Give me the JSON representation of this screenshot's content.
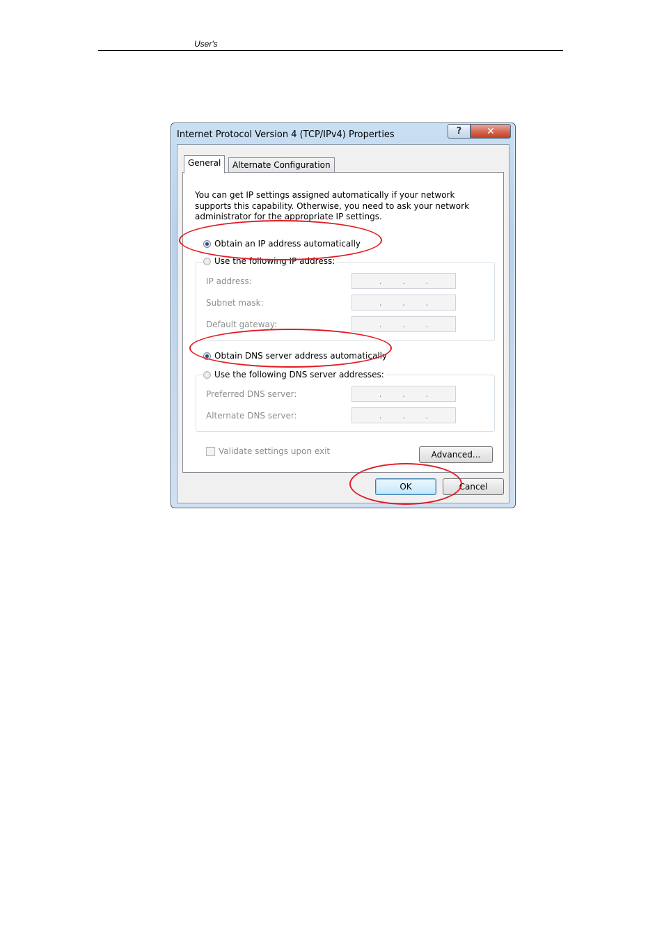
{
  "document": {
    "header_text": "User's"
  },
  "dialog": {
    "title": "Internet Protocol Version 4 (TCP/IPv4) Properties",
    "help_glyph": "?",
    "close_glyph": "✕",
    "tabs": [
      {
        "label": "General",
        "selected": true
      },
      {
        "label": "Alternate Configuration",
        "selected": false
      }
    ],
    "description": "You can get IP settings assigned automatically if your network supports this capability. Otherwise, you need to ask your network administrator for the appropriate IP settings.",
    "ip_mode": {
      "auto_label": "Obtain an IP address automatically",
      "auto_selected": true,
      "manual_label": "Use the following IP address:",
      "manual_selected": false
    },
    "ip_fields": {
      "ip_address_label": "IP address:",
      "subnet_mask_label": "Subnet mask:",
      "default_gateway_label": "Default gateway:",
      "dot": "."
    },
    "dns_mode": {
      "auto_label": "Obtain DNS server address automatically",
      "auto_selected": true,
      "manual_label": "Use the following DNS server addresses:",
      "manual_selected": false
    },
    "dns_fields": {
      "preferred_label": "Preferred DNS server:",
      "alternate_label": "Alternate DNS server:"
    },
    "validate_label": "Validate settings upon exit",
    "validate_checked": false,
    "advanced_label": "Advanced...",
    "ok_label": "OK",
    "cancel_label": "Cancel"
  },
  "annotation_color": "#e21b23"
}
